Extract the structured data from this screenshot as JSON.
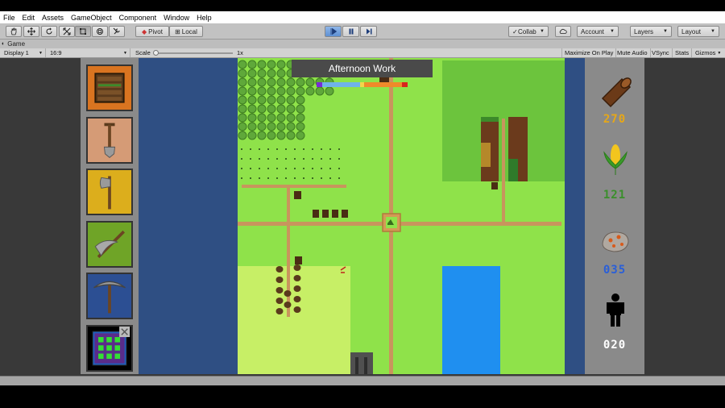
{
  "menu": [
    "File",
    "Edit",
    "Assets",
    "GameObject",
    "Component",
    "Window",
    "Help"
  ],
  "toolbar": {
    "pivot_label": "Pivot",
    "local_label": "Local",
    "collab_label": "Collab",
    "account_label": "Account",
    "layers_label": "Layers",
    "layout_label": "Layout"
  },
  "tab": {
    "label": "Game"
  },
  "game_toolbar": {
    "display": "Display 1",
    "aspect": "16:9",
    "scale_label": "Scale",
    "scale_value": "1x",
    "maximize_on_play": "Maximize On Play",
    "mute_audio": "Mute Audio",
    "vsync": "VSync",
    "stats": "Stats",
    "gizmos": "Gizmos"
  },
  "hud": {
    "title": "Afternoon Work",
    "time_bar_colors": [
      "#7a2bd6",
      "#6fb3ea",
      "#f2d64a",
      "#ef8a2a",
      "#d8241d"
    ],
    "resources": [
      {
        "name": "wood",
        "icon": "log-icon",
        "value": "270",
        "color": "#e6a718"
      },
      {
        "name": "corn",
        "icon": "corn-icon",
        "value": "121",
        "color": "#3a8f2b"
      },
      {
        "name": "ore",
        "icon": "ore-icon",
        "value": "035",
        "color": "#2a5fd8"
      },
      {
        "name": "population",
        "icon": "person-icon",
        "value": "020",
        "color": "#ffffff"
      }
    ]
  },
  "tools": [
    {
      "name": "build",
      "icon": "crate-icon",
      "bg": "#d97420"
    },
    {
      "name": "shovel",
      "icon": "shovel-icon",
      "bg": "#d59b76"
    },
    {
      "name": "axe",
      "icon": "axe-icon",
      "bg": "#dcae1c"
    },
    {
      "name": "scythe",
      "icon": "scythe-icon",
      "bg": "#6fa427"
    },
    {
      "name": "pickaxe",
      "icon": "pickaxe-icon",
      "bg": "#2c4f93"
    },
    {
      "name": "grid",
      "icon": "grid-icon",
      "bg": "#000000"
    }
  ]
}
